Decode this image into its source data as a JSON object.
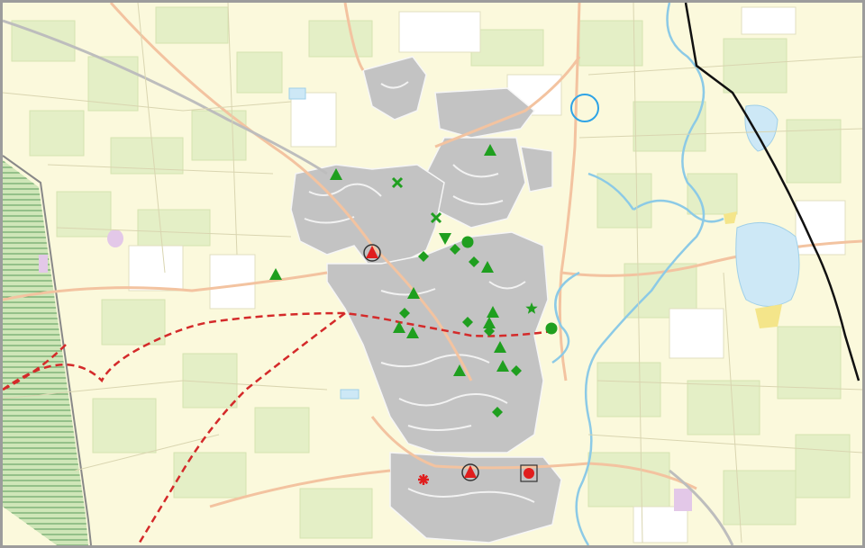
{
  "map": {
    "type": "topographic-city-map",
    "colors": {
      "background": "#fbf9dc",
      "rural_green": "#e4efc6",
      "urban_area": "#c3c3c3",
      "road": "#f3c3a0",
      "minor_road": "#ffffff",
      "water": "#cde8f6",
      "river": "#8ccae6",
      "railway": "#bdbdbd",
      "border_line": "#111111",
      "route": "#d42a2a",
      "marker_green": "#1f9f1f",
      "marker_red": "#e01e1e",
      "highlight_circle": "#2ea3e6"
    },
    "legend": [],
    "markers": [
      {
        "icon": "triangle-icon",
        "color": "green"
      },
      {
        "icon": "triangle-icon",
        "color": "green"
      },
      {
        "icon": "triangle-icon",
        "color": "green"
      },
      {
        "icon": "triangle-icon",
        "color": "green"
      },
      {
        "icon": "triangle-icon",
        "color": "green"
      },
      {
        "icon": "triangle-icon",
        "color": "green"
      },
      {
        "icon": "triangle-icon",
        "color": "green"
      },
      {
        "icon": "triangle-icon",
        "color": "green"
      },
      {
        "icon": "triangle-icon",
        "color": "green"
      },
      {
        "icon": "triangle-icon",
        "color": "green"
      },
      {
        "icon": "triangle-icon",
        "color": "green"
      },
      {
        "icon": "triangle-icon",
        "color": "green"
      },
      {
        "icon": "diamond-icon",
        "color": "green"
      },
      {
        "icon": "diamond-icon",
        "color": "green"
      },
      {
        "icon": "diamond-icon",
        "color": "green"
      },
      {
        "icon": "diamond-icon",
        "color": "green"
      },
      {
        "icon": "diamond-icon",
        "color": "green"
      },
      {
        "icon": "diamond-icon",
        "color": "green"
      },
      {
        "icon": "diamond-icon",
        "color": "green"
      },
      {
        "icon": "diamond-icon",
        "color": "green"
      },
      {
        "icon": "cross-icon",
        "color": "green"
      },
      {
        "icon": "cross-icon",
        "color": "green"
      },
      {
        "icon": "inverted-triangle-icon",
        "color": "green"
      },
      {
        "icon": "circle-icon",
        "color": "green"
      },
      {
        "icon": "circle-icon",
        "color": "green"
      },
      {
        "icon": "star-icon",
        "color": "green"
      },
      {
        "icon": "triangle-in-circle-icon",
        "color": "red"
      },
      {
        "icon": "triangle-in-circle-icon",
        "color": "red"
      },
      {
        "icon": "asterisk-icon",
        "color": "red"
      },
      {
        "icon": "circle-in-square-icon",
        "color": "red"
      },
      {
        "icon": "highlight-circle-icon",
        "color": "blue"
      }
    ]
  }
}
